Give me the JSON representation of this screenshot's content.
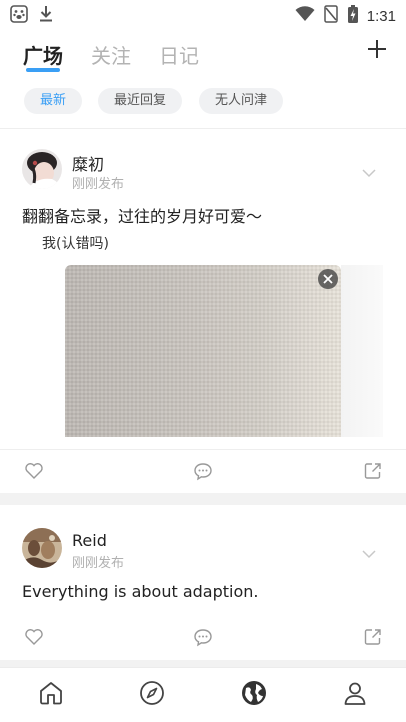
{
  "status_bar": {
    "time": "1:31",
    "icons": [
      "baidu-paw-icon",
      "download-icon",
      "wifi-icon",
      "no-signal-icon",
      "battery-charging-icon"
    ]
  },
  "header": {
    "tabs": [
      {
        "label": "广场",
        "active": true
      },
      {
        "label": "关注",
        "active": false
      },
      {
        "label": "日记",
        "active": false
      }
    ],
    "add_icon": "plus-icon"
  },
  "filters": [
    {
      "label": "最新",
      "active": true
    },
    {
      "label": "最近回复",
      "active": false
    },
    {
      "label": "无人问津",
      "active": false
    }
  ],
  "posts": [
    {
      "user": "糜初",
      "meta": "刚刚发布",
      "text": "翻翻备忘录，过往的岁月好可爱～",
      "subtext": "我(认错吗)",
      "has_image": true
    },
    {
      "user": "Reid",
      "meta": "刚刚发布",
      "text": "Everything is about adaption.",
      "has_image": false
    }
  ],
  "bottom_nav": {
    "items": [
      "home-icon",
      "compass-icon",
      "globe-icon",
      "profile-icon"
    ],
    "active": "globe-icon"
  },
  "colors": {
    "accent": "#3a9ff5",
    "muted": "#b3b3b3",
    "chip_bg": "#f0f1f3"
  }
}
